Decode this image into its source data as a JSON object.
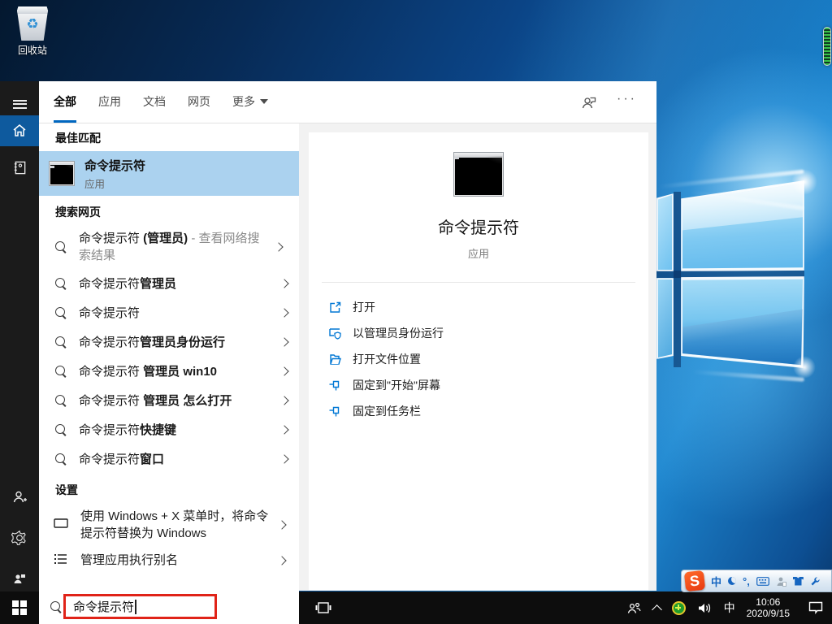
{
  "colors": {
    "accent_blue": "#0078d7",
    "best_match_highlight": "#abd2ef",
    "annotation_red": "#e02318",
    "sidebar_selected_blue": "#0e5a9e",
    "taskbar_black": "#0d0d0d"
  },
  "desktop": {
    "recycle_bin": {
      "label": "回收站",
      "icon": "recycle-bin-icon"
    },
    "memory_widget": {
      "icon": "memory-usage-gauge"
    }
  },
  "search_panel": {
    "sidebar_icons": [
      "menu-icon",
      "home-icon",
      "journal-icon",
      "account-icon",
      "gear-icon",
      "feedback-user-icon"
    ],
    "tabs": {
      "all": "全部",
      "apps": "应用",
      "documents": "文档",
      "web": "网页",
      "more": "更多"
    },
    "header_icons": [
      "feedback-bubble-icon",
      "ellipsis-icon"
    ],
    "best_match": {
      "header": "最佳匹配",
      "item": {
        "title": "命令提示符",
        "subtitle": "应用",
        "icon": "cmd-icon"
      }
    },
    "web_search": {
      "header": "搜索网页",
      "items": [
        {
          "pre": "命令提示符 ",
          "bold": "(管理员)",
          "post": " - 查看网络搜索结果"
        },
        {
          "pre": "命令提示符",
          "bold": "管理员",
          "post": ""
        },
        {
          "pre": "命令提示符",
          "bold": "",
          "post": ""
        },
        {
          "pre": "命令提示符",
          "bold": "管理员身份运行",
          "post": ""
        },
        {
          "pre": "命令提示符 ",
          "bold": "管理员 win10",
          "post": ""
        },
        {
          "pre": "命令提示符 ",
          "bold": "管理员 怎么打开",
          "post": ""
        },
        {
          "pre": "命令提示符",
          "bold": "快捷键",
          "post": ""
        },
        {
          "pre": "命令提示符",
          "bold": "窗口",
          "post": ""
        }
      ]
    },
    "settings": {
      "header": "设置",
      "items": [
        {
          "text": "使用 Windows + X 菜单时，将命令提示符替换为 Windows",
          "icon": "monitor-icon"
        },
        {
          "text": "管理应用执行别名",
          "icon": "list-icon"
        }
      ]
    },
    "search_box": {
      "value": "命令提示符"
    },
    "detail": {
      "title": "命令提示符",
      "subtitle": "应用",
      "icon": "cmd-icon-large",
      "actions": [
        {
          "label": "打开",
          "icon": "open-icon"
        },
        {
          "label": "以管理员身份运行",
          "icon": "run-as-admin-icon"
        },
        {
          "label": "打开文件位置",
          "icon": "file-location-icon"
        },
        {
          "label": "固定到\"开始\"屏幕",
          "icon": "pin-icon"
        },
        {
          "label": "固定到任务栏",
          "icon": "pin-icon"
        }
      ]
    }
  },
  "taskbar": {
    "start": "start-button",
    "task_view": "task-view-icon",
    "tray": {
      "people": "people-icon",
      "overflow": "chevron-up-icon",
      "antivirus": "green-security-icon",
      "volume": "speaker-icon",
      "ime_indicator": "中",
      "time": "10:06",
      "date": "2020/9/15",
      "action_center": "action-center-icon"
    }
  },
  "sogou_bar": {
    "logo": "S",
    "mode": "中",
    "punct": "°,",
    "icons": [
      "moon-icon",
      "punctuation-icon",
      "soft-keyboard-icon",
      "account-icon",
      "skin-icon",
      "toolbox-wrench-icon"
    ]
  }
}
